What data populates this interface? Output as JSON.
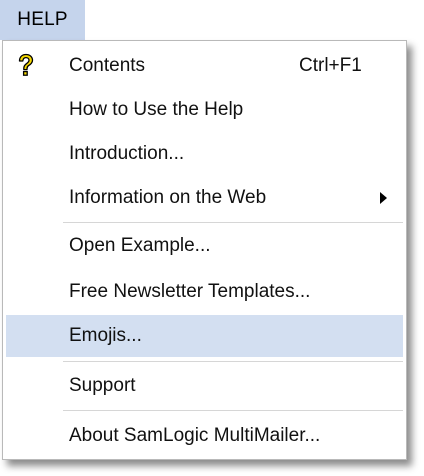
{
  "menubar": {
    "help_label": "HELP"
  },
  "menu": {
    "items": [
      {
        "label": "Contents",
        "shortcut": "Ctrl+F1",
        "icon": "help-question-icon"
      },
      {
        "label": "How to Use the Help"
      },
      {
        "label": "Introduction..."
      },
      {
        "label": "Information on the Web",
        "submenu": true
      },
      {
        "label": "Open Example..."
      },
      {
        "label": "Free Newsletter Templates..."
      },
      {
        "label": "Emojis...",
        "highlighted": true
      },
      {
        "label": "Support"
      },
      {
        "label": "About SamLogic MultiMailer..."
      }
    ]
  },
  "colors": {
    "menubar_active": "#c5d4ec",
    "highlight": "#d3dff1",
    "icon_yellow": "#f5d800"
  }
}
